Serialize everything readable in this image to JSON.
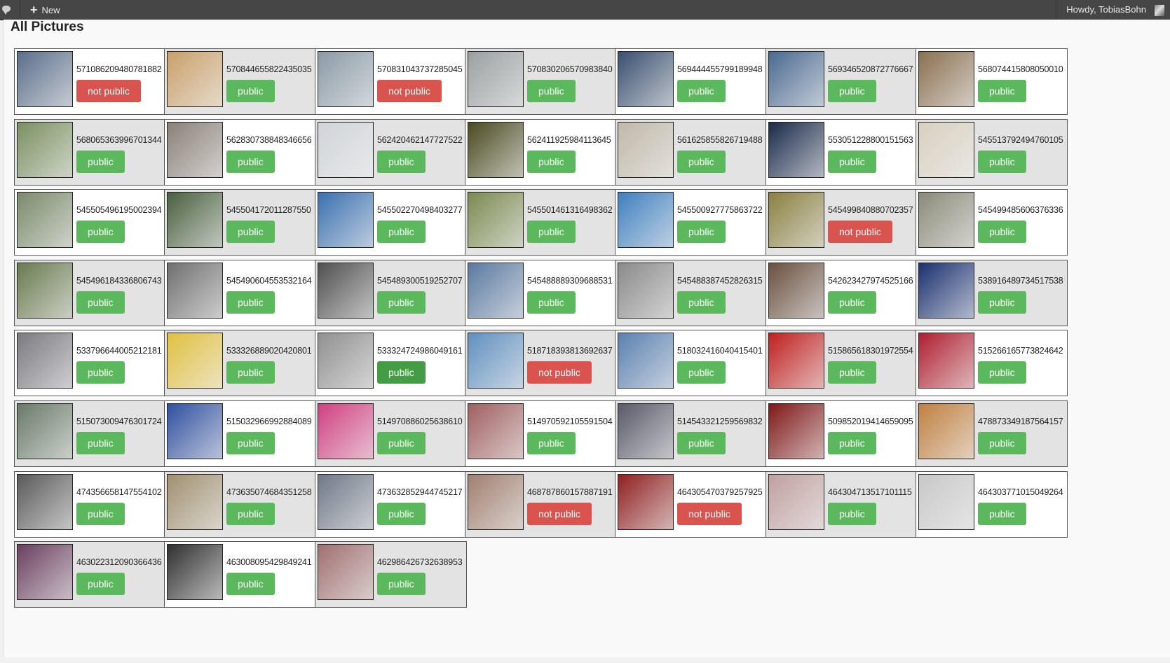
{
  "adminbar": {
    "new_label": "New",
    "greeting": "Howdy, TobiasBohn"
  },
  "page": {
    "title": "All Pictures"
  },
  "pictures": [
    {
      "id": "571086209480781882",
      "status": "not public",
      "color": "#5a6e8a"
    },
    {
      "id": "570844655822435035",
      "status": "public",
      "color": "#c9a06a"
    },
    {
      "id": "570831043737285045",
      "status": "not public",
      "color": "#8a9aa6"
    },
    {
      "id": "570830206570983840",
      "status": "public",
      "color": "#9aa0a0"
    },
    {
      "id": "569444455799189948",
      "status": "public",
      "color": "#3a5070"
    },
    {
      "id": "569346520872776667",
      "status": "public",
      "color": "#4a6a90"
    },
    {
      "id": "568074415808050010",
      "status": "public",
      "color": "#8a7050"
    },
    {
      "id": "568065363996701344",
      "status": "public",
      "color": "#7a9060"
    },
    {
      "id": "562830738848346656",
      "status": "public",
      "color": "#8a8078"
    },
    {
      "id": "562420462147727522",
      "status": "public",
      "color": "#d0d4d8"
    },
    {
      "id": "562411925984113645",
      "status": "public",
      "color": "#4a4a20"
    },
    {
      "id": "561625855826719488",
      "status": "public",
      "color": "#c0b8a8"
    },
    {
      "id": "553051228800151563",
      "status": "public",
      "color": "#1a2a4a"
    },
    {
      "id": "545513792494760105",
      "status": "public",
      "color": "#d8d0c0"
    },
    {
      "id": "545505496195002394",
      "status": "public",
      "color": "#7a8a6a"
    },
    {
      "id": "545504172011287550",
      "status": "public",
      "color": "#4a6040"
    },
    {
      "id": "545502270498403277",
      "status": "public",
      "color": "#3a70b0"
    },
    {
      "id": "545501461316498362",
      "status": "public",
      "color": "#7a8a50"
    },
    {
      "id": "545500927775863722",
      "status": "public",
      "color": "#4080c0"
    },
    {
      "id": "545499840880702357",
      "status": "not public",
      "color": "#8a8040"
    },
    {
      "id": "545499485606376336",
      "status": "public",
      "color": "#8a8a7a"
    },
    {
      "id": "545496184336806743",
      "status": "public",
      "color": "#6a7a50"
    },
    {
      "id": "545490604553532164",
      "status": "public",
      "color": "#707070"
    },
    {
      "id": "545489300519252707",
      "status": "public",
      "color": "#505050"
    },
    {
      "id": "545488889309688531",
      "status": "public",
      "color": "#5a7aa0"
    },
    {
      "id": "545488387452826315",
      "status": "public",
      "color": "#8a8a8a"
    },
    {
      "id": "542623427974525166",
      "status": "public",
      "color": "#6a5040"
    },
    {
      "id": "538916489734517538",
      "status": "public",
      "color": "#1a3070"
    },
    {
      "id": "533796644005212181",
      "status": "public",
      "color": "#7a7a80"
    },
    {
      "id": "533326889020420801",
      "status": "public",
      "color": "#e0c040"
    },
    {
      "id": "533324724986049161",
      "status": "public",
      "color": "#909090"
    },
    {
      "id": "518718393813692637",
      "status": "not public",
      "color": "#6090c0"
    },
    {
      "id": "518032416040415401",
      "status": "public",
      "color": "#5a80b0"
    },
    {
      "id": "515865618301972554",
      "status": "public",
      "color": "#c02020"
    },
    {
      "id": "515266165773824642",
      "status": "public",
      "color": "#b02030"
    },
    {
      "id": "515073009476301724",
      "status": "public",
      "color": "#6a7a6a"
    },
    {
      "id": "515032966992884089",
      "status": "public",
      "color": "#3050a0"
    },
    {
      "id": "514970886025638610",
      "status": "public",
      "color": "#d04080"
    },
    {
      "id": "514970592105591504",
      "status": "public",
      "color": "#a06060"
    },
    {
      "id": "514543321259569832",
      "status": "public",
      "color": "#5a5a6a"
    },
    {
      "id": "509852019414659095",
      "status": "public",
      "color": "#801818"
    },
    {
      "id": "478873349187564157",
      "status": "public",
      "color": "#c08040"
    },
    {
      "id": "474356658147554102",
      "status": "public",
      "color": "#5a5a5a"
    },
    {
      "id": "473635074684351258",
      "status": "public",
      "color": "#a09070"
    },
    {
      "id": "473632852944745217",
      "status": "public",
      "color": "#707888"
    },
    {
      "id": "468787860157887191",
      "status": "not public",
      "color": "#a08070"
    },
    {
      "id": "464305470379257925",
      "status": "not public",
      "color": "#902020"
    },
    {
      "id": "464304713517101115",
      "status": "public",
      "color": "#c0a0a0"
    },
    {
      "id": "464303771015049264",
      "status": "public",
      "color": "#c8c8c8"
    },
    {
      "id": "463022312090366436",
      "status": "public",
      "color": "#6a4060"
    },
    {
      "id": "463008095429849241",
      "status": "public",
      "color": "#303030"
    },
    {
      "id": "462986426732638953",
      "status": "public",
      "color": "#a07070"
    }
  ]
}
